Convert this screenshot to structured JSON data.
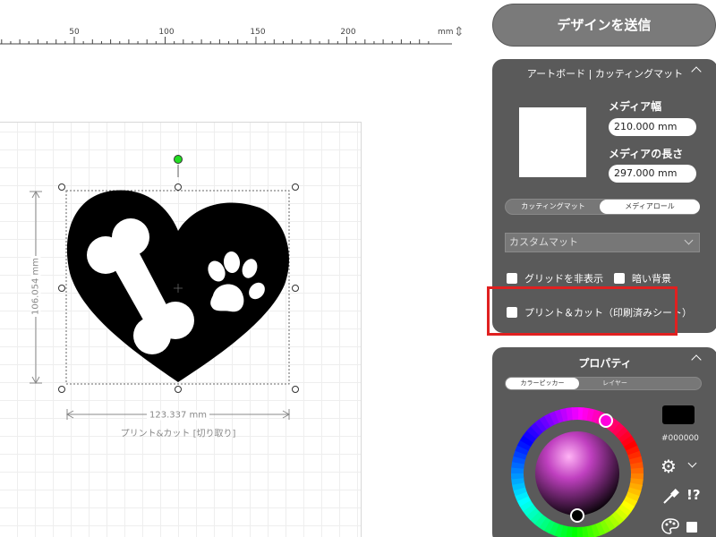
{
  "ruler": {
    "ticks": [
      "50",
      "100",
      "150",
      "200"
    ],
    "unit": "mm"
  },
  "canvas": {
    "height_dim": "106.054 mm",
    "width_dim": "123.337 mm",
    "object_caption": "プリント&カット [切り取り]"
  },
  "send_button": {
    "label": "デザインを送信"
  },
  "artboard_panel": {
    "title": "アートボード | カッティングマット",
    "media_width_label": "メディア幅",
    "media_width_value": "210.000 mm",
    "media_length_label": "メディアの長さ",
    "media_length_value": "297.000 mm",
    "mode_tabs": [
      "カッティングマット",
      "メディアロール"
    ],
    "selected_mode": "メディアロール",
    "mat_dropdown": "カスタムマット",
    "hide_grid_label": "グリッドを非表示",
    "dark_bg_label": "暗い背景",
    "print_cut_label": "プリント＆カット（印刷済みシート）"
  },
  "properties_panel": {
    "title": "プロパティ",
    "tabs": [
      "カラーピッカー",
      "レイヤー"
    ],
    "selected_tab": "カラーピッカー",
    "color_hex": "#000000"
  },
  "colors": {
    "panel_bg": "#5a5a5a",
    "highlight": "#e02020",
    "selected_color": "#000000",
    "hue_handle": "#ff00dd"
  },
  "icons": {
    "ruler_toggle": "vertical-resize-icon",
    "collapse": "chevron-up-icon",
    "dropdown": "chevron-down-icon",
    "settings": "gear-icon",
    "eyedropper": "eyedropper-icon",
    "palette": "palette-icon",
    "help": "exclamation-question-icon"
  }
}
